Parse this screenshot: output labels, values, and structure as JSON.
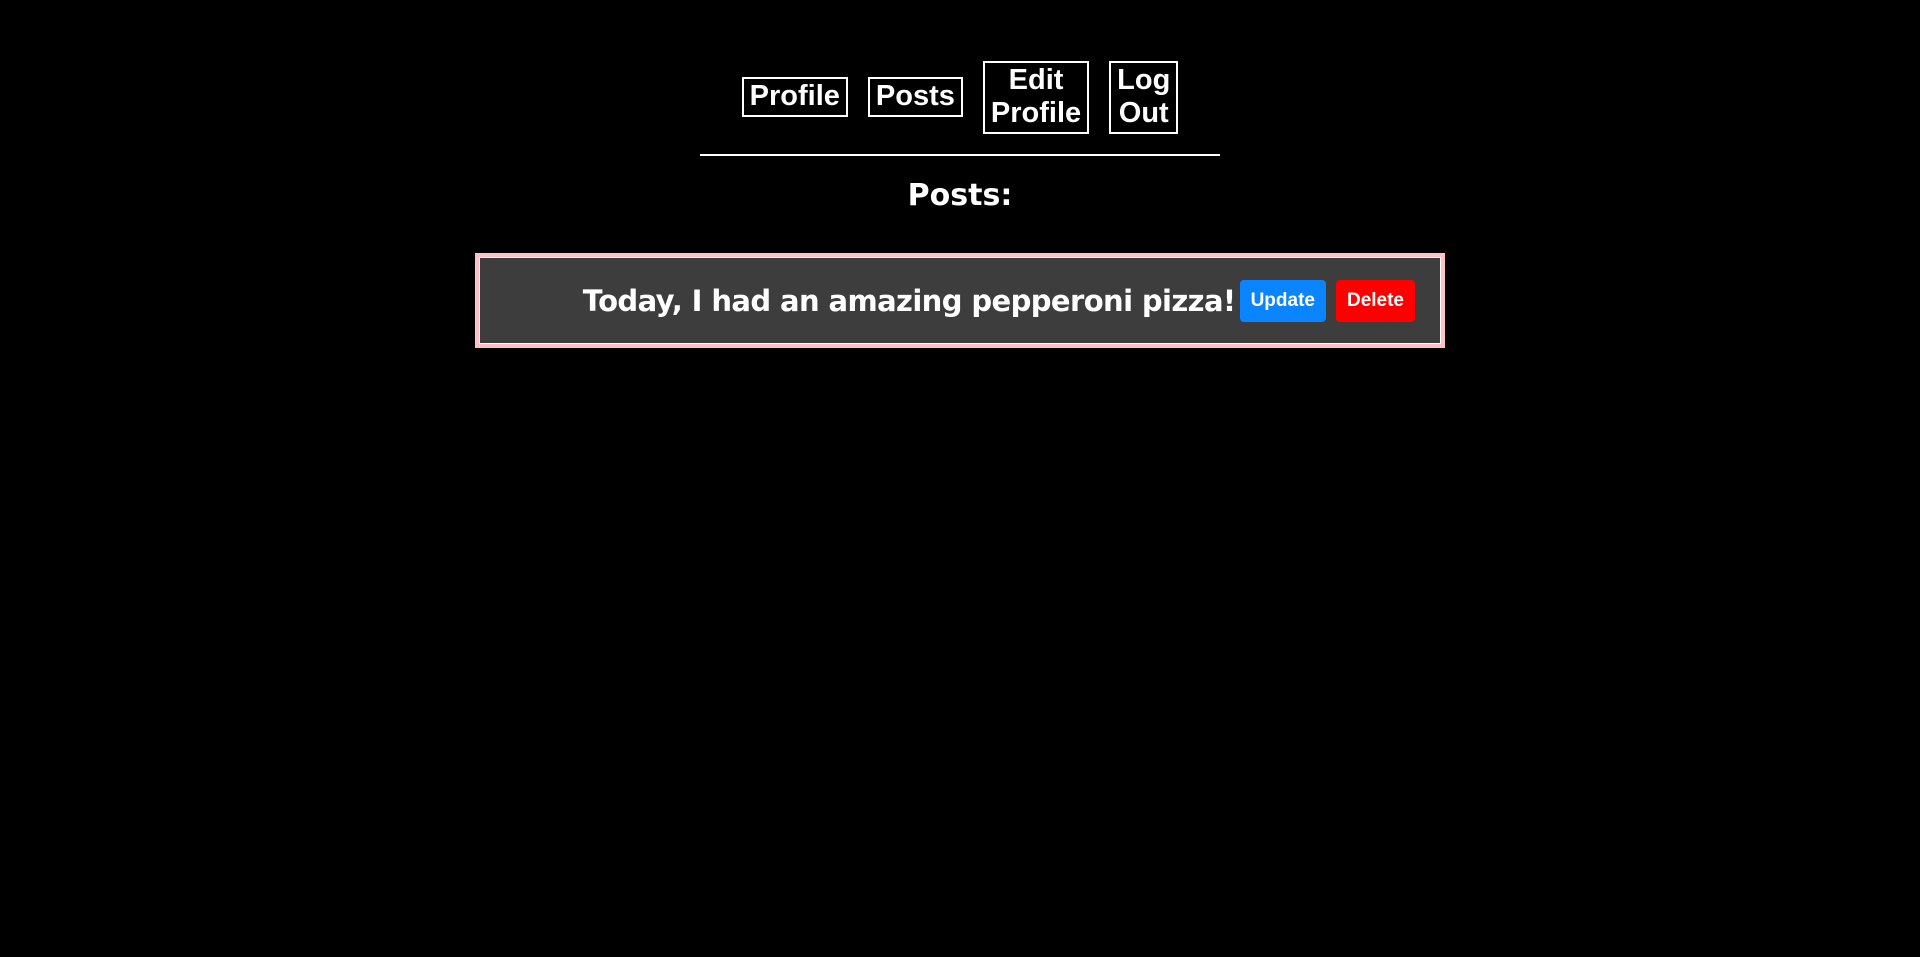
{
  "nav": {
    "profile": [
      "Profile"
    ],
    "posts": [
      "Posts"
    ],
    "edit_profile": [
      "Edit",
      "Profile"
    ],
    "log_out": [
      "Log",
      "Out"
    ]
  },
  "main": {
    "heading": "Posts:",
    "posts": [
      {
        "text": "Today, I had an amazing pepperoni pizza!",
        "update_label": "Update",
        "delete_label": "Delete"
      }
    ]
  },
  "colors": {
    "background": "#000000",
    "card_background": "#3d3d3d",
    "card_border": "#ffc0c8",
    "update_button": "#0a84ff",
    "delete_button": "#ff0000"
  }
}
